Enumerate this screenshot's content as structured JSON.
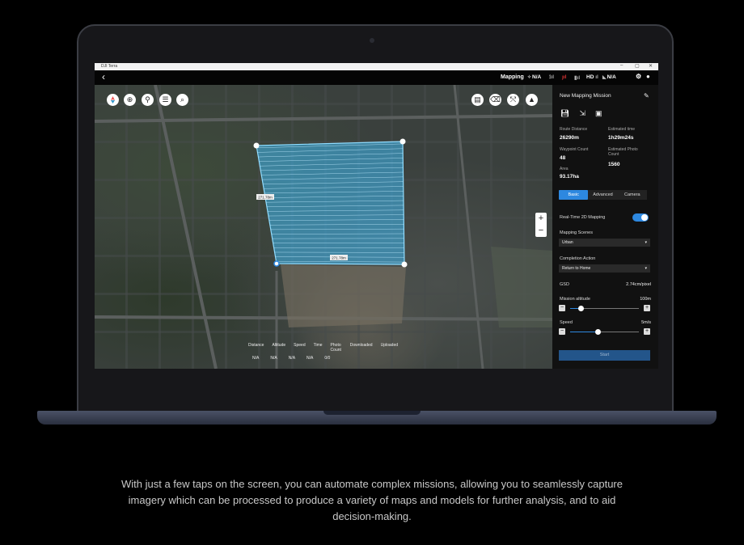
{
  "window": {
    "title": "DJI Terra",
    "controls": [
      "–",
      "▢",
      "✕"
    ]
  },
  "topbar": {
    "back_icon": "‹",
    "mode_label": "Mapping",
    "gps_value": "N/A",
    "hd_label": "HD",
    "signal_value": "N/A"
  },
  "map_controls": {
    "compass_icon": "compass-icon",
    "locate_icon": "crosshair-icon",
    "pin_icon": "pin-icon",
    "list_icon": "list-icon",
    "search_icon": "search-icon",
    "zoom_in": "+",
    "zoom_out": "−"
  },
  "mission_area": {
    "label_a": "271.78m",
    "label_b": "271.78m"
  },
  "telemetry": {
    "labels": [
      "Distance",
      "Altitude",
      "Speed",
      "Time",
      "Photo Count",
      "Downloaded",
      "Uploaded"
    ],
    "values": [
      "N/A",
      "N/A",
      "N/A",
      "N/A",
      "0/0"
    ]
  },
  "panel": {
    "title": "New Mapping Mission",
    "route_distance_label": "Route Distance",
    "route_distance": "26290m",
    "estimated_time_label": "Estimated time",
    "estimated_time": "1h29m24s",
    "waypoint_count_label": "Waypoint Count",
    "waypoint_count": "48",
    "photo_count_label": "Estimated Photo Count",
    "photo_count": "1560",
    "area_label": "Area",
    "area": "93.17ha",
    "tabs": [
      "Basic",
      "Advanced",
      "Camera"
    ],
    "realtime_label": "Real-Time 2D Mapping",
    "realtime_on": true,
    "scenes_label": "Mapping Scenes",
    "scenes_value": "Urban",
    "completion_label": "Completion Action",
    "completion_value": "Return to Home",
    "gsd_label": "GSD",
    "gsd_value": "2.74cm/pixel",
    "altitude_label": "Mission altitude",
    "altitude_value": "100m",
    "altitude_level": 0.15,
    "speed_label": "Speed",
    "speed_value": "5m/s",
    "speed_level": 0.4,
    "start_label": "Start"
  },
  "caption": "With just a few taps on the screen, you can automate complex missions, allowing you to seamlessly capture imagery which can be processed to produce a variety of maps and models for further analysis, and to aid decision-making.",
  "colors": {
    "accent": "#2d88e0",
    "mission_fill": "#3fb8f0"
  }
}
